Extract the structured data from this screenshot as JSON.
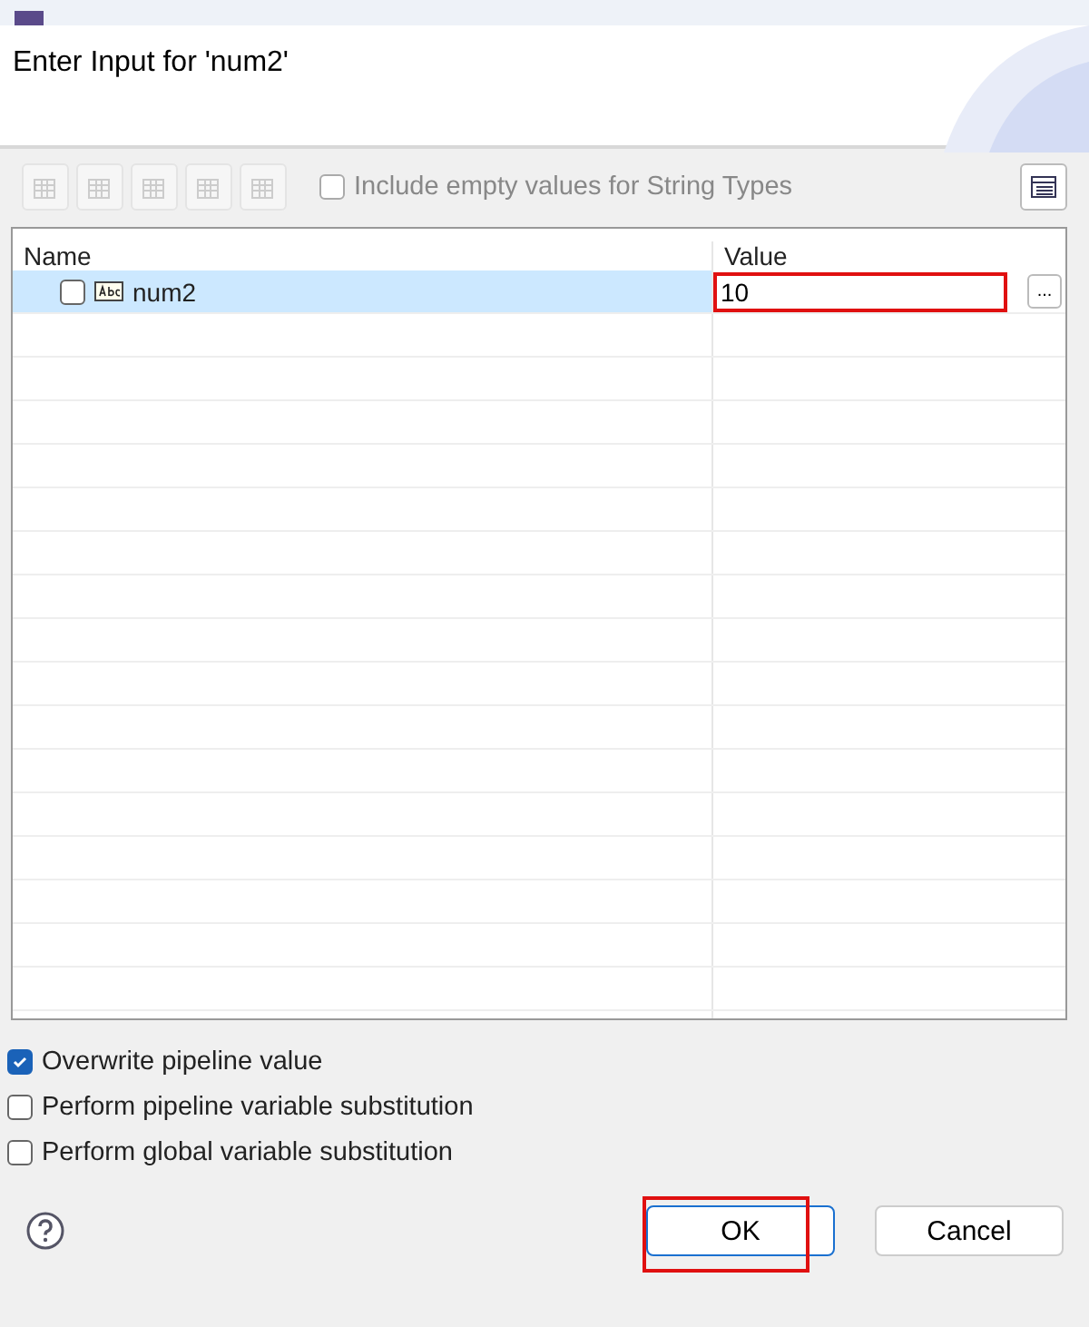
{
  "header": {
    "title": "Enter Input for 'num2'"
  },
  "toolbar": {
    "include_empty": {
      "label": "Include empty values for String Types",
      "checked": false,
      "disabled": true
    }
  },
  "table": {
    "columns": [
      "Name",
      "Value"
    ],
    "rows": [
      {
        "name": "num2",
        "value": "10",
        "checked": false,
        "selected": true,
        "highlighted": true,
        "browse": "..."
      }
    ]
  },
  "options": [
    {
      "label": "Overwrite pipeline value",
      "checked": true
    },
    {
      "label": "Perform pipeline variable substitution",
      "checked": false
    },
    {
      "label": "Perform global variable substitution",
      "checked": false
    }
  ],
  "buttons": [
    {
      "label": "OK",
      "default": true,
      "highlighted": true
    },
    {
      "label": "Cancel",
      "default": false,
      "highlighted": false
    }
  ]
}
